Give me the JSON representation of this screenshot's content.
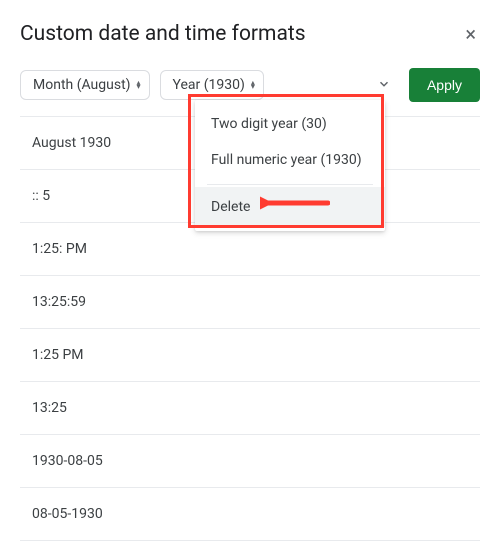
{
  "title": "Custom date and time formats",
  "close_label": "×",
  "pills": {
    "month": "Month (August)",
    "year": "Year (1930)"
  },
  "caret_glyph": "⌄",
  "apply_label": "Apply",
  "dropdown": {
    "two_digit": "Two digit year (30)",
    "full_numeric": "Full numeric year (1930)",
    "delete": "Delete"
  },
  "rows": {
    "r0": "August 1930",
    "r1": ":: 5",
    "r2": "1:25: PM",
    "r3": "13:25:59",
    "r4": "1:25 PM",
    "r5": "13:25",
    "r6": "1930-08-05",
    "r7": "08-05-1930"
  }
}
